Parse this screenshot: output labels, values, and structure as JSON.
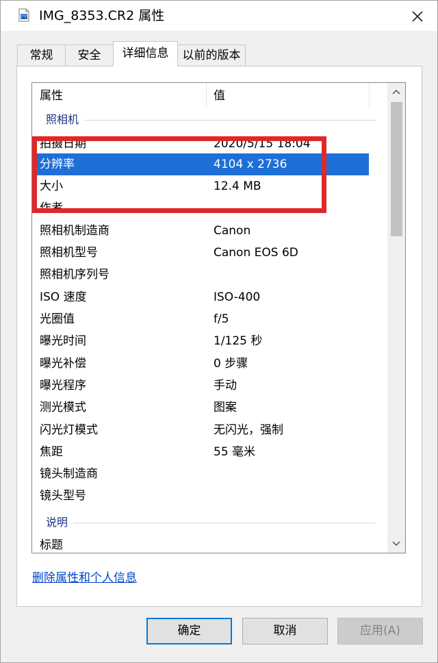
{
  "window": {
    "title": "IMG_8353.CR2 属性",
    "icon": "image-file-icon"
  },
  "tabs": [
    {
      "label": "常规",
      "active": false
    },
    {
      "label": "安全",
      "active": false
    },
    {
      "label": "详细信息",
      "active": true
    },
    {
      "label": "以前的版本",
      "active": false
    }
  ],
  "list": {
    "columns": {
      "property": "属性",
      "value": "值"
    },
    "groups": {
      "camera": "照相机",
      "description": "说明"
    },
    "rows": [
      {
        "key": "拍摄日期",
        "value": "2020/5/15 18:04"
      },
      {
        "key": "分辨率",
        "value": "4104 x 2736",
        "selected": true
      },
      {
        "key": "大小",
        "value": "12.4 MB"
      },
      {
        "key": "作者",
        "value": ""
      },
      {
        "key": "照相机制造商",
        "value": "Canon"
      },
      {
        "key": "照相机型号",
        "value": "Canon EOS 6D"
      },
      {
        "key": "照相机序列号",
        "value": ""
      },
      {
        "key": "ISO 速度",
        "value": "ISO-400"
      },
      {
        "key": "光圈值",
        "value": "f/5"
      },
      {
        "key": "曝光时间",
        "value": "1/125 秒"
      },
      {
        "key": "曝光补偿",
        "value": "0 步骤"
      },
      {
        "key": "曝光程序",
        "value": "手动"
      },
      {
        "key": "测光模式",
        "value": "图案"
      },
      {
        "key": "闪光灯模式",
        "value": "无闪光，强制"
      },
      {
        "key": "焦距",
        "value": "55 毫米"
      },
      {
        "key": "镜头制造商",
        "value": ""
      },
      {
        "key": "镜头型号",
        "value": ""
      }
    ],
    "after_description": [
      {
        "key": "标题",
        "value": ""
      }
    ]
  },
  "link": {
    "label": "删除属性和个人信息"
  },
  "buttons": {
    "ok": "确定",
    "cancel": "取消",
    "apply": "应用(A)"
  },
  "colors": {
    "selection": "#1e6fd8",
    "annotation": "#e02828",
    "group_text": "#1e3287",
    "link": "#0046c8"
  }
}
